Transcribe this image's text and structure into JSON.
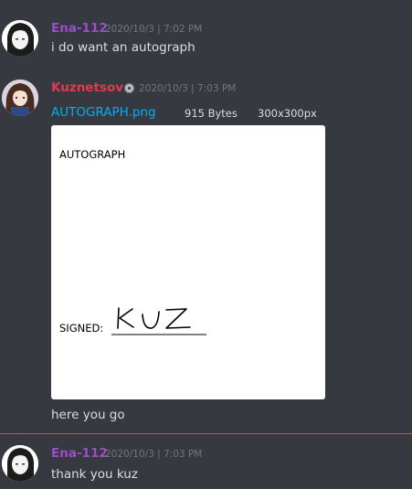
{
  "messages": [
    {
      "author": "Ena-112",
      "author_color": "#9b4dca",
      "timestamp": "2020/10/3 | 7:02 PM",
      "text": "i do want an autograph"
    },
    {
      "author": "Kuznetsov",
      "author_color": "#e53950",
      "badge_icon": "verified-badge-icon",
      "timestamp": "2020/10/3 | 7:03 PM",
      "attachment": {
        "filename": "AUTOGRAPH.png",
        "size": "915 Bytes",
        "dimensions": "300x300px",
        "image_title": "AUTOGRAPH",
        "signed_label": "SIGNED:",
        "signature": "KUZ"
      },
      "text": "here you go"
    },
    {
      "author": "Ena-112",
      "author_color": "#9b4dca",
      "timestamp": "2020/10/3 | 7:03 PM",
      "text": "thank you kuz"
    }
  ],
  "colors": {
    "background": "#36393f",
    "link": "#00b0f4",
    "new_divider": "#ed4245"
  }
}
